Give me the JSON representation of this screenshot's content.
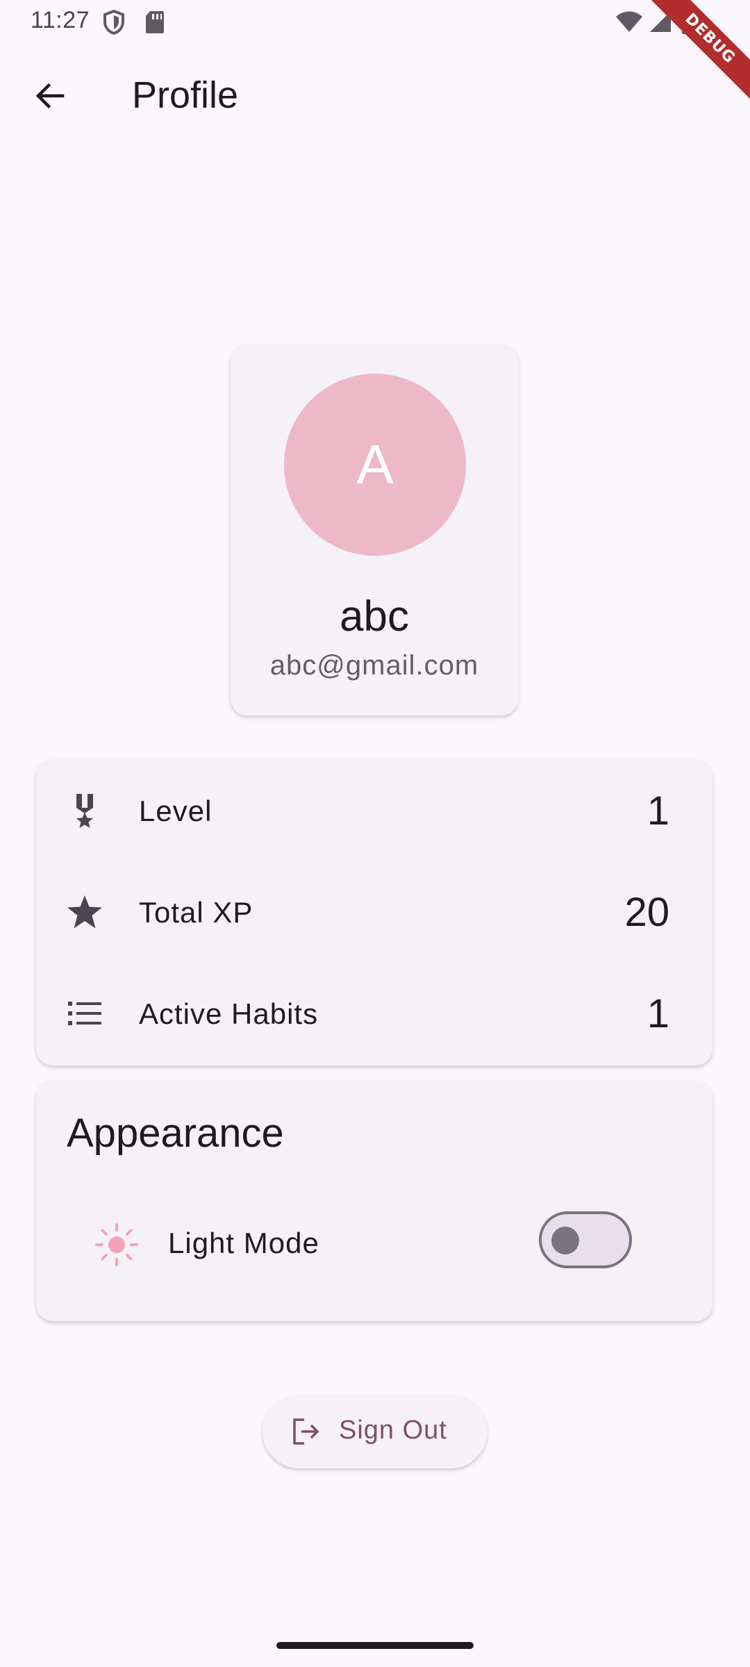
{
  "status_bar": {
    "time": "11:27"
  },
  "debug_banner": {
    "label": "DEBUG"
  },
  "app_bar": {
    "title": "Profile",
    "back_icon": "arrow-back-icon"
  },
  "profile": {
    "avatar_initial": "A",
    "name": "abc",
    "email": "abc@gmail.com"
  },
  "stats": [
    {
      "icon": "military-medal-icon",
      "label": "Level",
      "value": "1"
    },
    {
      "icon": "star-icon",
      "label": "Total XP",
      "value": "20"
    },
    {
      "icon": "list-icon",
      "label": "Active Habits",
      "value": "1"
    }
  ],
  "appearance": {
    "title": "Appearance",
    "toggle_label": "Light Mode",
    "toggle_on": false,
    "icon": "sun-icon"
  },
  "sign_out": {
    "label": "Sign Out",
    "icon": "logout-icon"
  },
  "colors": {
    "background": "#fcf7fc",
    "card": "#f6f1f7",
    "avatar": "#edb8c8",
    "accent": "#7d5260",
    "sun": "#f5a3bb"
  }
}
